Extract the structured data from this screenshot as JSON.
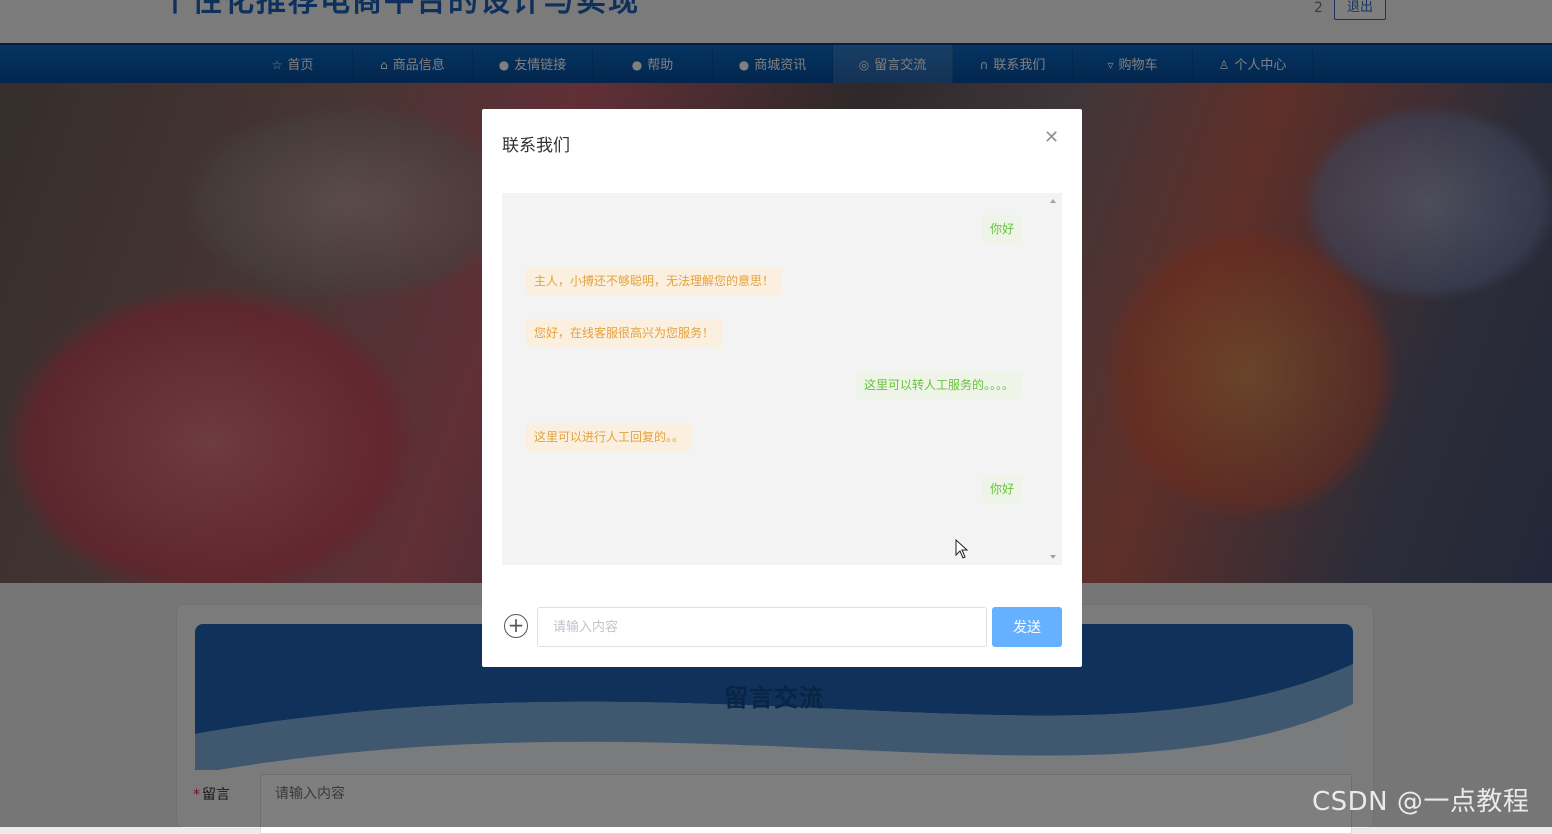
{
  "header": {
    "site_title": "个性化推荐电商平台的设计与实现",
    "user_count": "2",
    "logout_label": "退出"
  },
  "nav": {
    "items": [
      {
        "label": "首页",
        "icon": "star-icon",
        "glyph": "☆"
      },
      {
        "label": "商品信息",
        "icon": "bag-icon",
        "glyph": "⌂"
      },
      {
        "label": "友情链接",
        "icon": "info-icon",
        "glyph": "●"
      },
      {
        "label": "帮助",
        "icon": "help-icon",
        "glyph": "●"
      },
      {
        "label": "商城资讯",
        "icon": "info-icon",
        "glyph": "●"
      },
      {
        "label": "留言交流",
        "icon": "globe-icon",
        "glyph": "◎"
      },
      {
        "label": "联系我们",
        "icon": "headset-icon",
        "glyph": "∩"
      },
      {
        "label": "购物车",
        "icon": "cart-icon",
        "glyph": "▿"
      },
      {
        "label": "个人中心",
        "icon": "user-icon",
        "glyph": "♙"
      }
    ],
    "active_index": 5
  },
  "content": {
    "section_title": "留言交流",
    "form_label": "留言",
    "textarea_placeholder": "请输入内容"
  },
  "dialog": {
    "title": "联系我们",
    "messages": [
      {
        "from": "me",
        "text": "你好"
      },
      {
        "from": "bot",
        "text": "主人，小搏还不够聪明，无法理解您的意思！"
      },
      {
        "from": "bot",
        "text": "您好，在线客服很高兴为您服务！"
      },
      {
        "from": "me",
        "text": "这里可以转人工服务的。。。。"
      },
      {
        "from": "bot",
        "text": "这里可以进行人工回复的。。"
      },
      {
        "from": "me",
        "text": "你好"
      }
    ],
    "input_placeholder": "请输入内容",
    "input_value": "",
    "send_label": "发送"
  },
  "watermark": "CSDN @一点教程",
  "colors": {
    "nav_bg": "#0a5fb8",
    "send_button": "#66b1ff",
    "my_message_text": "#67c23a",
    "bot_message_text": "#e6a23c",
    "title_blue": "#1a63b8"
  }
}
